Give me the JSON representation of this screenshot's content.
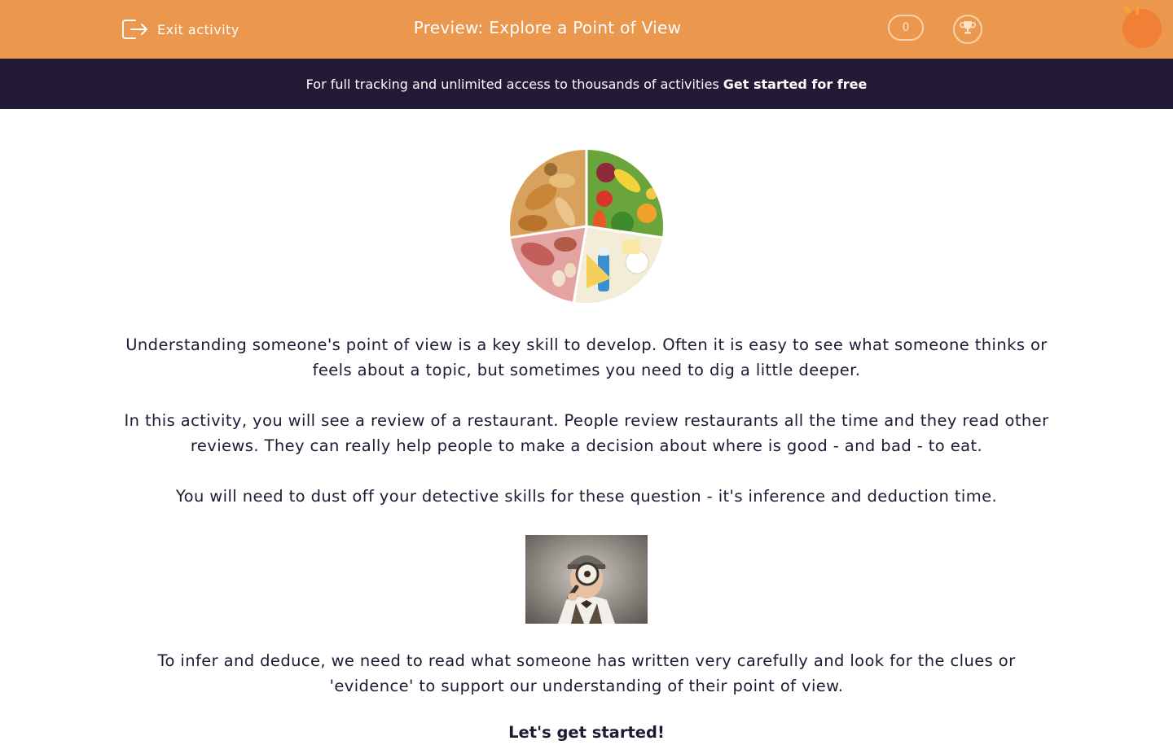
{
  "header": {
    "exit_label": "Exit activity",
    "title": "Preview: Explore a Point of View",
    "score": "0",
    "accent_color": "#eb984e"
  },
  "promo": {
    "text": "For full tracking and unlimited access to thousands of activities",
    "link": "Get started for free",
    "background": "#231a36"
  },
  "intro": {
    "paragraphs": [
      "Understanding someone's point of view is a key skill to develop. Often it is easy to see what someone thinks or feels about a topic, but sometimes you need to dig a little deeper.",
      "In this activity, you will see a review of a restaurant. People review restaurants all the time and they read other reviews. They can really help people to make a decision about where is good - and bad - to eat.",
      "You will need to dust off your detective skills for these question - it's inference and deduction time.",
      "To infer and deduce, we need to read what someone has written very carefully and look for the clues or 'evidence' to support our understanding of their point of view."
    ],
    "cutoff_line": "Let's get started!"
  },
  "icons": [
    "exit-icon",
    "trophy-icon",
    "orange-logo-icon"
  ],
  "images": [
    "food-groups-wheel",
    "boy-detective-with-magnifying-glass"
  ]
}
